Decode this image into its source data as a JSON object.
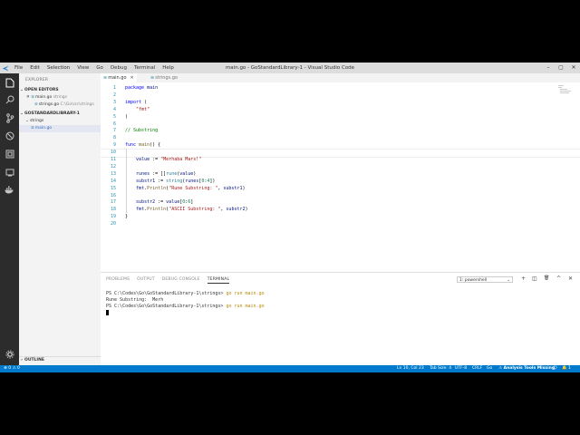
{
  "window": {
    "title": "main.go - GoStandardLibrary-1 - Visual Studio Code",
    "menu": [
      "File",
      "Edit",
      "Selection",
      "View",
      "Go",
      "Debug",
      "Terminal",
      "Help"
    ],
    "controls": {
      "minimize": "–",
      "maximize": "▢",
      "close": "✕"
    }
  },
  "sidebar": {
    "header": "EXPLORER",
    "open_editors_label": "OPEN EDITORS",
    "open_editors": [
      {
        "prefix": "✕",
        "name": "main.go",
        "detail": "strings"
      },
      {
        "prefix": "",
        "name": "strings.go",
        "detail": "C:\\Go\\src\\strings"
      }
    ],
    "folder_label": "GOSTANDARDLIBRARY-1",
    "tree_folder": "strings",
    "tree_file": "main.go",
    "outline_label": "OUTLINE"
  },
  "tabs": [
    {
      "label": "main.go",
      "close": "✕",
      "active": true
    },
    {
      "label": "strings.go",
      "close": "",
      "active": false
    }
  ],
  "code": [
    {
      "n": "1",
      "t": "package main"
    },
    {
      "n": "2",
      "t": ""
    },
    {
      "n": "3",
      "t": "import ("
    },
    {
      "n": "4",
      "t": "    \"fmt\""
    },
    {
      "n": "5",
      "t": ")"
    },
    {
      "n": "6",
      "t": ""
    },
    {
      "n": "7",
      "t": "// Substring"
    },
    {
      "n": "8",
      "t": ""
    },
    {
      "n": "9",
      "t": "func main() {"
    },
    {
      "n": "10",
      "t": ""
    },
    {
      "n": "11",
      "t": "    value := \"Merhaba Mars!\""
    },
    {
      "n": "12",
      "t": ""
    },
    {
      "n": "13",
      "t": "    runes := []rune(value)"
    },
    {
      "n": "14",
      "t": "    substr1 := string(runes[0:4])"
    },
    {
      "n": "15",
      "t": "    fmt.Println(\"Rune Substring: \", substr1)"
    },
    {
      "n": "16",
      "t": ""
    },
    {
      "n": "17",
      "t": "    substr2 := value[0:6]"
    },
    {
      "n": "18",
      "t": "    fmt.Println(\"ASCII Substring: \", substr2)"
    },
    {
      "n": "19",
      "t": "}"
    },
    {
      "n": "20",
      "t": ""
    }
  ],
  "panel": {
    "tabs": [
      "PROBLEMS",
      "OUTPUT",
      "DEBUG CONSOLE",
      "TERMINAL"
    ],
    "active_tab": "TERMINAL",
    "terminal_select": "1: powershell",
    "controls": {
      "add": "+",
      "split": "◫",
      "trash": "🗑",
      "up": "^",
      "close": "✕"
    },
    "lines": [
      {
        "prompt": "PS C:\\Codes\\Go\\GoStandardLibrary-1\\strings> ",
        "cmd": "go run main.go"
      },
      {
        "prompt": "Rune Substring:  Merh",
        "cmd": ""
      },
      {
        "prompt": "PS C:\\Codes\\Go\\GoStandardLibrary-1\\strings> ",
        "cmd": "go run main.go"
      }
    ]
  },
  "statusbar": {
    "problems": "⊗ 0 ⚠ 0",
    "position": "Ln 10, Col 23",
    "tab_size": "Tab Size: 4",
    "encoding": "UTF-8",
    "eol": "CRLF",
    "language": "Go",
    "analysis": "⚠ Analysis Tools Missing",
    "smiley": "☺",
    "bell": "🔔 1"
  },
  "colors": {
    "statusbar": "#007acc",
    "activitybar": "#2c2c2c",
    "keyword": "#0000ff",
    "string": "#a31515",
    "comment": "#008000",
    "func": "#795e26",
    "var": "#001080",
    "type": "#267f99",
    "number": "#098658",
    "terminal_cmd": "#b8860b"
  }
}
